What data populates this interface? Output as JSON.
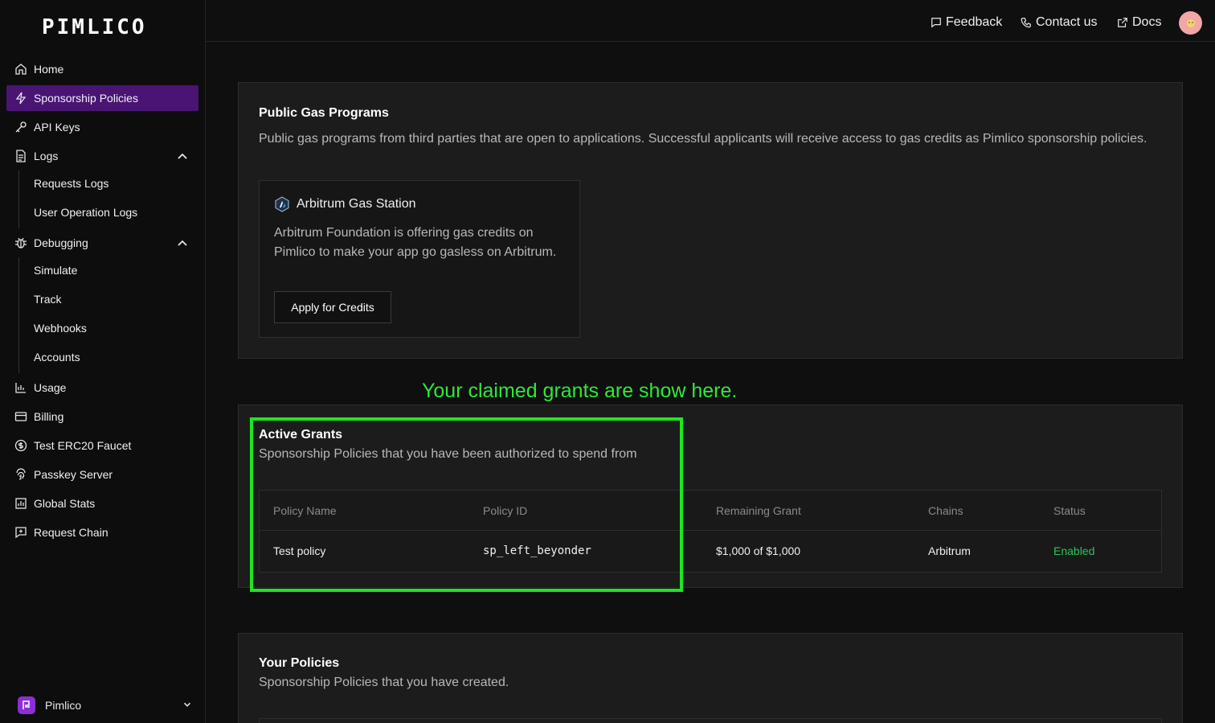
{
  "sidebar": {
    "logo": "PIMLICO",
    "items": {
      "home": "Home",
      "sponsorship": "Sponsorship Policies",
      "api_keys": "API Keys",
      "logs": "Logs",
      "requests_logs": "Requests Logs",
      "user_op_logs": "User Operation Logs",
      "debugging": "Debugging",
      "simulate": "Simulate",
      "track": "Track",
      "webhooks": "Webhooks",
      "accounts": "Accounts",
      "usage": "Usage",
      "billing": "Billing",
      "faucet": "Test ERC20 Faucet",
      "passkey": "Passkey Server",
      "global_stats": "Global Stats",
      "request_chain": "Request Chain"
    },
    "org_name": "Pimlico"
  },
  "header": {
    "feedback": "Feedback",
    "contact": "Contact us",
    "docs": "Docs"
  },
  "public_programs": {
    "title": "Public Gas Programs",
    "description": "Public gas programs from third parties that are open to applications. Successful applicants will receive access to gas credits as Pimlico sponsorship policies.",
    "program": {
      "name": "Arbitrum Gas Station",
      "description": "Arbitrum Foundation is offering gas credits on Pimlico to make your app go gasless on Arbitrum.",
      "button": "Apply for Credits"
    }
  },
  "annotation": "Your claimed grants are show here.",
  "active_grants": {
    "title": "Active Grants",
    "description": "Sponsorship Policies that you have been authorized to spend from",
    "columns": {
      "policy_name": "Policy Name",
      "policy_id": "Policy ID",
      "remaining": "Remaining Grant",
      "chains": "Chains",
      "status": "Status"
    },
    "rows": [
      {
        "policy_name": "Test policy",
        "policy_id": "sp_left_beyonder",
        "remaining": "$1,000 of $1,000",
        "chains": "Arbitrum",
        "status": "Enabled"
      }
    ]
  },
  "your_policies": {
    "title": "Your Policies",
    "description": "Sponsorship Policies that you have created."
  },
  "colors": {
    "accent": "#4a1475",
    "annotation": "#2fe83a",
    "status_enabled": "#2ec45a"
  }
}
